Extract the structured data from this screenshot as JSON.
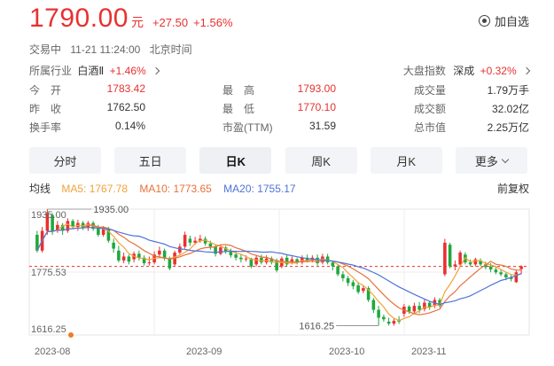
{
  "quote": {
    "price": "1790.00",
    "unit": "元",
    "change": "+27.50",
    "change_pct": "+1.56%",
    "watch_label": "加自选",
    "watch_icon": "add-watchlist-icon"
  },
  "status": {
    "state": "交易中",
    "time": "11-21 11:24:00",
    "zone": "北京时间"
  },
  "industry": {
    "label": "所属行业",
    "name": "白酒Ⅱ",
    "change": "+1.46%",
    "index_label": "大盘指数",
    "index_name": "深成",
    "index_change": "+0.32%"
  },
  "stats": {
    "open_label": "今　开",
    "open": "1783.42",
    "high_label": "最　高",
    "high": "1793.00",
    "volume_label": "成交量",
    "volume": "1.79万手",
    "prev_close_label": "昨　收",
    "prev_close": "1762.50",
    "low_label": "最　低",
    "low": "1770.10",
    "turnover_label": "成交额",
    "turnover": "32.02亿",
    "turnover_rate_label": "换手率",
    "turnover_rate": "0.14%",
    "pe_label": "市盈(TTM)",
    "pe": "31.59",
    "market_cap_label": "总市值",
    "market_cap": "2.25万亿"
  },
  "tabs": [
    {
      "label": "分时"
    },
    {
      "label": "五日"
    },
    {
      "label": "日K"
    },
    {
      "label": "周K"
    },
    {
      "label": "月K"
    },
    {
      "label": "更多"
    }
  ],
  "ma": {
    "title": "均线",
    "ma5": "MA5: 1767.78",
    "ma10": "MA10: 1773.65",
    "ma20": "MA20: 1755.17",
    "adjust": "前复权"
  },
  "colors": {
    "up": "#e93030",
    "down": "#1fa83c",
    "ma5": "#f1a23b",
    "ma10": "#e8703a",
    "ma20": "#4f74d8",
    "current_line": "#e93030"
  },
  "chart_data": {
    "type": "candlestick",
    "y_axis_labels": [
      "1935.00",
      "1775.53",
      "1616.25"
    ],
    "ylim": [
      1616.25,
      1935.0
    ],
    "x_axis_labels": [
      "2023-08",
      "2023-09",
      "2023-10",
      "2023-11"
    ],
    "annotations": {
      "max": "1935.00",
      "min": "1616.25"
    },
    "current_price": 1790.0,
    "ref_price": 1775.53,
    "candles": [
      [
        1870,
        1830,
        1880,
        1825
      ],
      [
        1830,
        1880,
        1890,
        1825
      ],
      [
        1880,
        1925,
        1935,
        1870
      ],
      [
        1920,
        1880,
        1925,
        1870
      ],
      [
        1880,
        1895,
        1905,
        1875
      ],
      [
        1895,
        1880,
        1900,
        1870
      ],
      [
        1880,
        1905,
        1912,
        1875
      ],
      [
        1905,
        1890,
        1910,
        1885
      ],
      [
        1890,
        1900,
        1908,
        1880
      ],
      [
        1900,
        1888,
        1905,
        1882
      ],
      [
        1888,
        1900,
        1905,
        1880
      ],
      [
        1900,
        1885,
        1905,
        1880
      ],
      [
        1890,
        1870,
        1895,
        1865
      ],
      [
        1870,
        1885,
        1892,
        1865
      ],
      [
        1885,
        1855,
        1890,
        1850
      ],
      [
        1850,
        1835,
        1860,
        1825
      ],
      [
        1830,
        1805,
        1842,
        1800
      ],
      [
        1805,
        1815,
        1825,
        1798
      ],
      [
        1815,
        1802,
        1820,
        1795
      ],
      [
        1808,
        1822,
        1828,
        1800
      ],
      [
        1822,
        1812,
        1830,
        1805
      ],
      [
        1812,
        1798,
        1818,
        1792
      ],
      [
        1798,
        1800,
        1815,
        1792
      ],
      [
        1800,
        1820,
        1828,
        1795
      ],
      [
        1820,
        1830,
        1840,
        1815
      ],
      [
        1830,
        1810,
        1835,
        1805
      ],
      [
        1810,
        1785,
        1815,
        1780
      ],
      [
        1795,
        1825,
        1830,
        1790
      ],
      [
        1825,
        1840,
        1848,
        1820
      ],
      [
        1840,
        1870,
        1878,
        1835
      ],
      [
        1860,
        1850,
        1868,
        1842
      ],
      [
        1850,
        1855,
        1865,
        1845
      ],
      [
        1855,
        1860,
        1870,
        1850
      ],
      [
        1860,
        1848,
        1866,
        1842
      ],
      [
        1848,
        1840,
        1855,
        1832
      ],
      [
        1840,
        1822,
        1845,
        1815
      ],
      [
        1822,
        1838,
        1845,
        1818
      ],
      [
        1838,
        1828,
        1842,
        1822
      ],
      [
        1828,
        1818,
        1835,
        1812
      ],
      [
        1820,
        1812,
        1828,
        1805
      ],
      [
        1812,
        1808,
        1822,
        1800
      ],
      [
        1808,
        1810,
        1818,
        1802
      ],
      [
        1810,
        1790,
        1812,
        1785
      ],
      [
        1795,
        1812,
        1818,
        1790
      ],
      [
        1812,
        1800,
        1820,
        1795
      ],
      [
        1800,
        1810,
        1818,
        1795
      ],
      [
        1810,
        1800,
        1815,
        1795
      ],
      [
        1805,
        1780,
        1810,
        1775
      ],
      [
        1790,
        1810,
        1815,
        1785
      ],
      [
        1812,
        1795,
        1818,
        1790
      ],
      [
        1800,
        1808,
        1815,
        1795
      ],
      [
        1808,
        1800,
        1812,
        1795
      ],
      [
        1800,
        1812,
        1818,
        1795
      ],
      [
        1812,
        1805,
        1820,
        1800
      ],
      [
        1805,
        1812,
        1818,
        1800
      ],
      [
        1812,
        1798,
        1820,
        1792
      ],
      [
        1800,
        1815,
        1822,
        1795
      ],
      [
        1815,
        1800,
        1822,
        1795
      ],
      [
        1800,
        1790,
        1805,
        1780
      ],
      [
        1790,
        1770,
        1795,
        1765
      ],
      [
        1770,
        1760,
        1778,
        1752
      ],
      [
        1760,
        1748,
        1766,
        1740
      ],
      [
        1750,
        1740,
        1756,
        1732
      ],
      [
        1742,
        1725,
        1748,
        1720
      ],
      [
        1728,
        1735,
        1742,
        1722
      ],
      [
        1735,
        1705,
        1740,
        1700
      ],
      [
        1705,
        1680,
        1710,
        1672
      ],
      [
        1680,
        1660,
        1690,
        1640
      ],
      [
        1662,
        1656,
        1668,
        1650
      ],
      [
        1650,
        1645,
        1660,
        1640
      ],
      [
        1645,
        1652,
        1660,
        1640
      ],
      [
        1655,
        1650,
        1664,
        1644
      ],
      [
        1670,
        1688,
        1695,
        1662
      ],
      [
        1688,
        1676,
        1692,
        1670
      ],
      [
        1676,
        1690,
        1698,
        1670
      ],
      [
        1690,
        1680,
        1700,
        1672
      ],
      [
        1682,
        1698,
        1706,
        1676
      ],
      [
        1698,
        1686,
        1702,
        1680
      ],
      [
        1690,
        1705,
        1712,
        1684
      ],
      [
        1705,
        1690,
        1710,
        1685
      ],
      [
        1770,
        1850,
        1860,
        1765
      ],
      [
        1845,
        1790,
        1850,
        1785
      ],
      [
        1790,
        1795,
        1805,
        1780
      ],
      [
        1795,
        1825,
        1830,
        1790
      ],
      [
        1820,
        1800,
        1826,
        1795
      ],
      [
        1800,
        1795,
        1808,
        1790
      ],
      [
        1795,
        1808,
        1812,
        1790
      ],
      [
        1805,
        1795,
        1810,
        1790
      ],
      [
        1795,
        1788,
        1802,
        1782
      ],
      [
        1790,
        1782,
        1798,
        1775
      ],
      [
        1782,
        1775,
        1790,
        1770
      ],
      [
        1775,
        1770,
        1782,
        1765
      ],
      [
        1770,
        1762,
        1776,
        1755
      ],
      [
        1762,
        1758,
        1770,
        1752
      ],
      [
        1750,
        1775,
        1780,
        1748
      ],
      [
        1783.42,
        1790,
        1793,
        1770.1
      ]
    ]
  }
}
